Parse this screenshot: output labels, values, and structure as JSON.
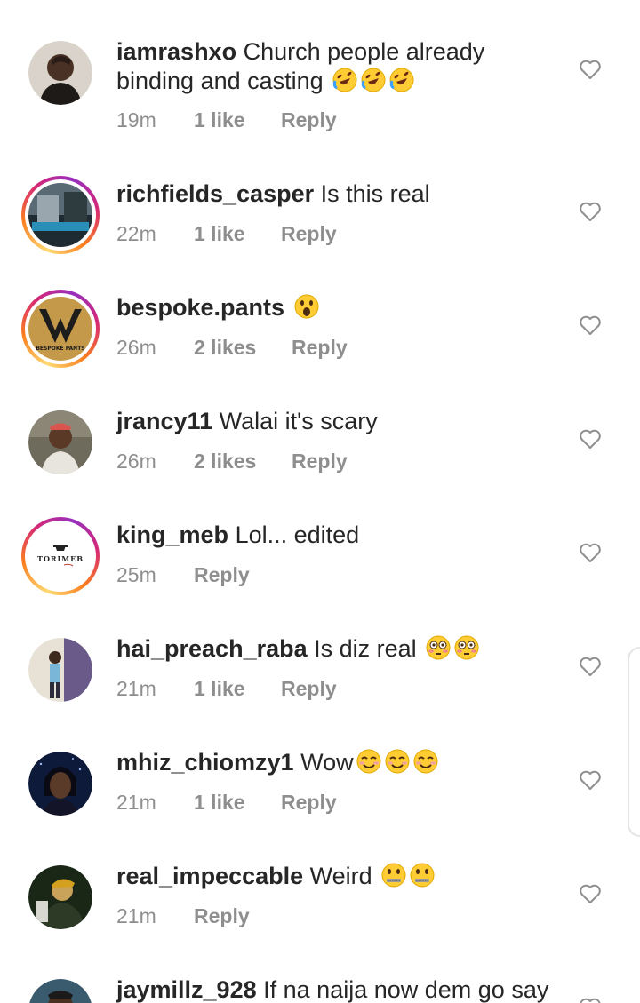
{
  "comments": [
    {
      "username": "iamrashxo",
      "text": "Church people already binding and casting",
      "emoji": "rofl",
      "emoji_count": 3,
      "time": "19m",
      "likes": "1 like",
      "reply": "Reply",
      "story": false
    },
    {
      "username": "richfields_casper",
      "text": "Is this real",
      "emoji": "",
      "emoji_count": 0,
      "time": "22m",
      "likes": "1 like",
      "reply": "Reply",
      "story": true
    },
    {
      "username": "bespoke.pants",
      "text": "",
      "emoji": "open-mouth",
      "emoji_count": 1,
      "time": "26m",
      "likes": "2 likes",
      "reply": "Reply",
      "story": true
    },
    {
      "username": "jrancy11",
      "text": "Walai it's scary",
      "emoji": "",
      "emoji_count": 0,
      "time": "26m",
      "likes": "2 likes",
      "reply": "Reply",
      "story": false
    },
    {
      "username": "king_meb",
      "text": "Lol... edited",
      "emoji": "",
      "emoji_count": 0,
      "time": "25m",
      "likes": "",
      "reply": "Reply",
      "story": true
    },
    {
      "username": "hai_preach_raba",
      "text": "Is diz real",
      "emoji": "flushed",
      "emoji_count": 2,
      "time": "21m",
      "likes": "1 like",
      "reply": "Reply",
      "story": false
    },
    {
      "username": "mhiz_chiomzy1",
      "text": "Wow",
      "emoji": "blush",
      "emoji_count": 3,
      "time": "21m",
      "likes": "1 like",
      "reply": "Reply",
      "story": false
    },
    {
      "username": "real_impeccable",
      "text": "Weird",
      "emoji": "zipper-mouth",
      "emoji_count": 2,
      "time": "21m",
      "likes": "",
      "reply": "Reply",
      "story": false
    },
    {
      "username": "jaymillz_928",
      "text": "If na naija now dem go say",
      "emoji": "",
      "emoji_count": 0,
      "time": "",
      "likes": "",
      "reply": "",
      "story": false
    }
  ],
  "avatar_logos": {
    "bespoke": "BESPOKE PANTS",
    "kingmeb": "TORIMEB"
  },
  "colors": {
    "text": "#262626",
    "meta": "#8e8e8e",
    "story_ring_start": "#fa7e1e",
    "story_ring_end": "#d62976"
  },
  "icons": {
    "heart": "heart-outline-icon"
  }
}
